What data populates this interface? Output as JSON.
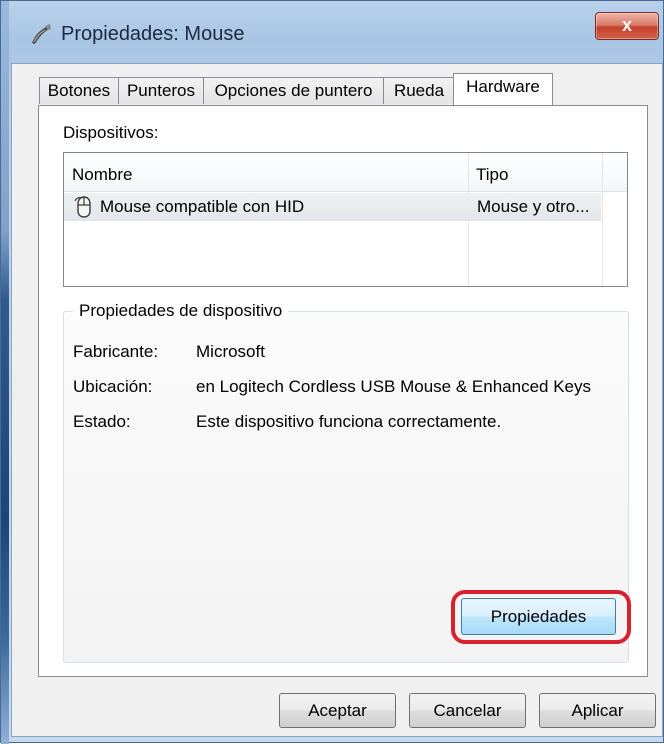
{
  "window": {
    "title": "Propiedades: Mouse",
    "close_label": "x"
  },
  "tabs": [
    {
      "label": "Botones"
    },
    {
      "label": "Punteros"
    },
    {
      "label": "Opciones de puntero"
    },
    {
      "label": "Rueda"
    },
    {
      "label": "Hardware",
      "active": true
    }
  ],
  "devices": {
    "label": "Dispositivos:",
    "columns": [
      "Nombre",
      "Tipo"
    ],
    "rows": [
      {
        "name": "Mouse compatible con HID",
        "type": "Mouse y otro...",
        "icon": "mouse-icon"
      }
    ]
  },
  "device_properties": {
    "group_title": "Propiedades de dispositivo",
    "fields": [
      {
        "label": "Fabricante:",
        "value": "Microsoft"
      },
      {
        "label": "Ubicación:",
        "value": "en Logitech Cordless USB Mouse & Enhanced Keys"
      },
      {
        "label": "Estado:",
        "value": "Este dispositivo funciona correctamente."
      }
    ],
    "properties_button": "Propiedades"
  },
  "footer": {
    "ok": "Aceptar",
    "cancel": "Cancelar",
    "apply": "Aplicar"
  },
  "colors": {
    "highlight": "#d9202e",
    "close_button": "#c4402b"
  }
}
